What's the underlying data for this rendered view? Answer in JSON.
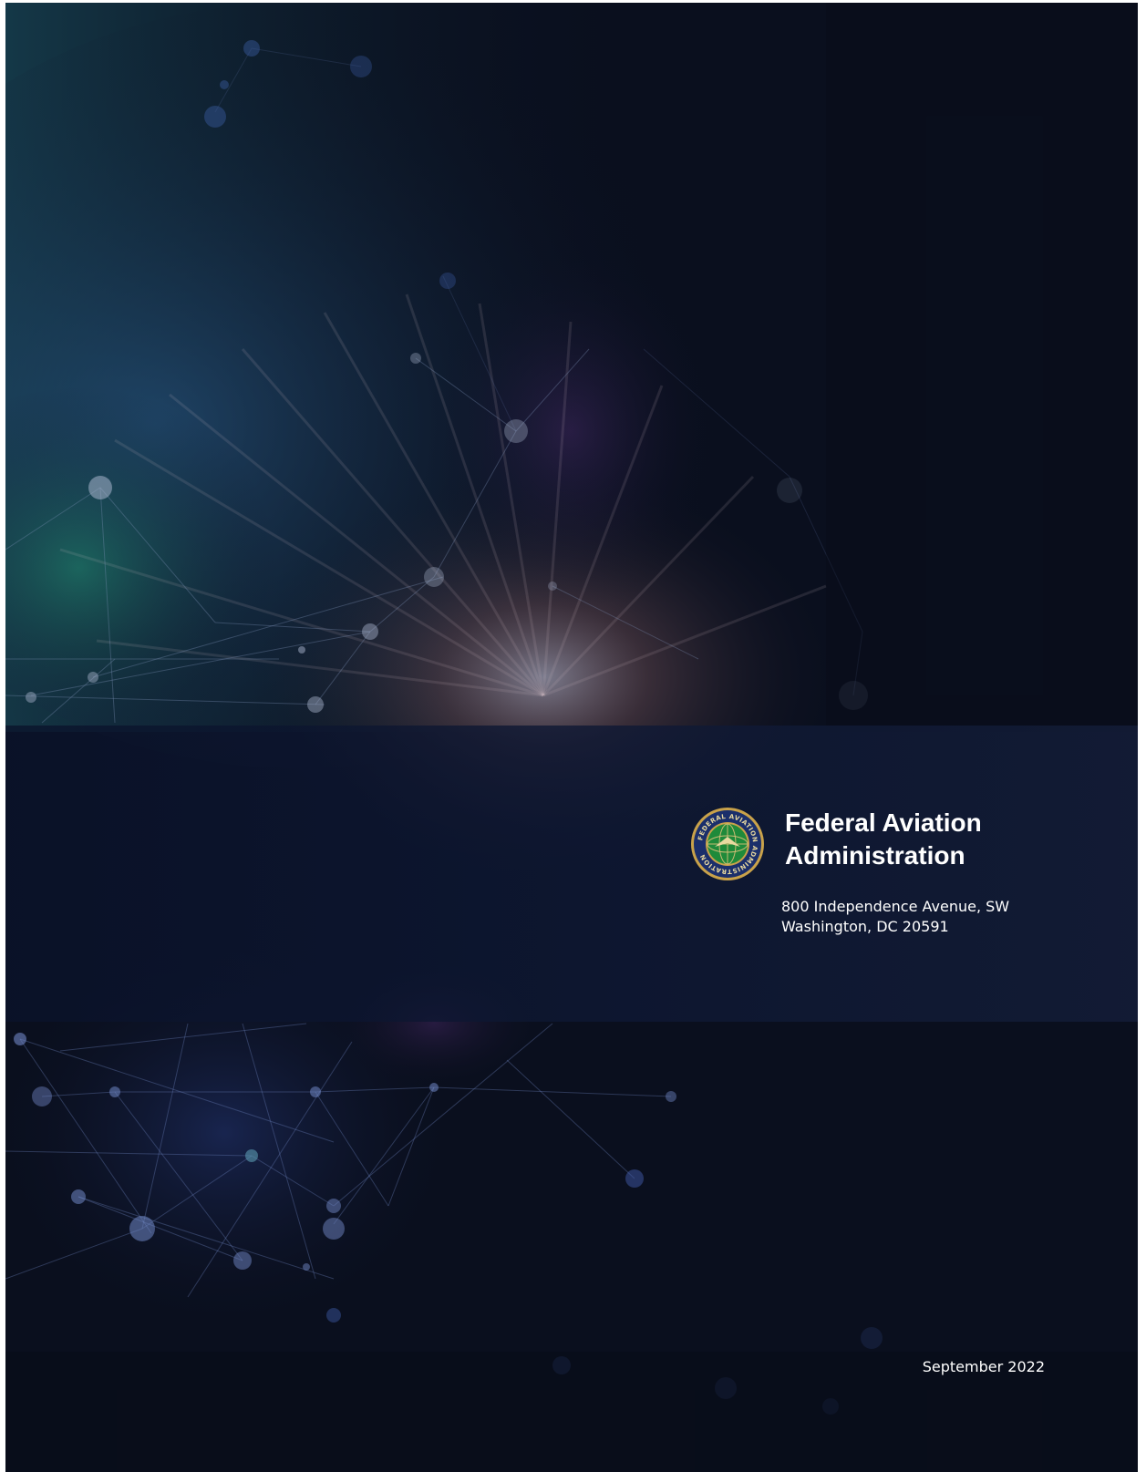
{
  "organization": {
    "name_line1": "Federal Aviation",
    "name_line2": "Administration",
    "seal": {
      "icon": "faa-seal-icon",
      "ring_text": "FEDERAL AVIATION ADMINISTRATION"
    }
  },
  "address": {
    "line1": "800 Independence Avenue, SW",
    "line2": "Washington,  DC 20591"
  },
  "date": "September 2022",
  "colors": {
    "background": "#0b1020",
    "band": "#101a36",
    "text": "#ffffff",
    "seal_gold": "#c9a24a",
    "seal_blue": "#1b2f6b",
    "seal_green": "#1f8a3a"
  }
}
